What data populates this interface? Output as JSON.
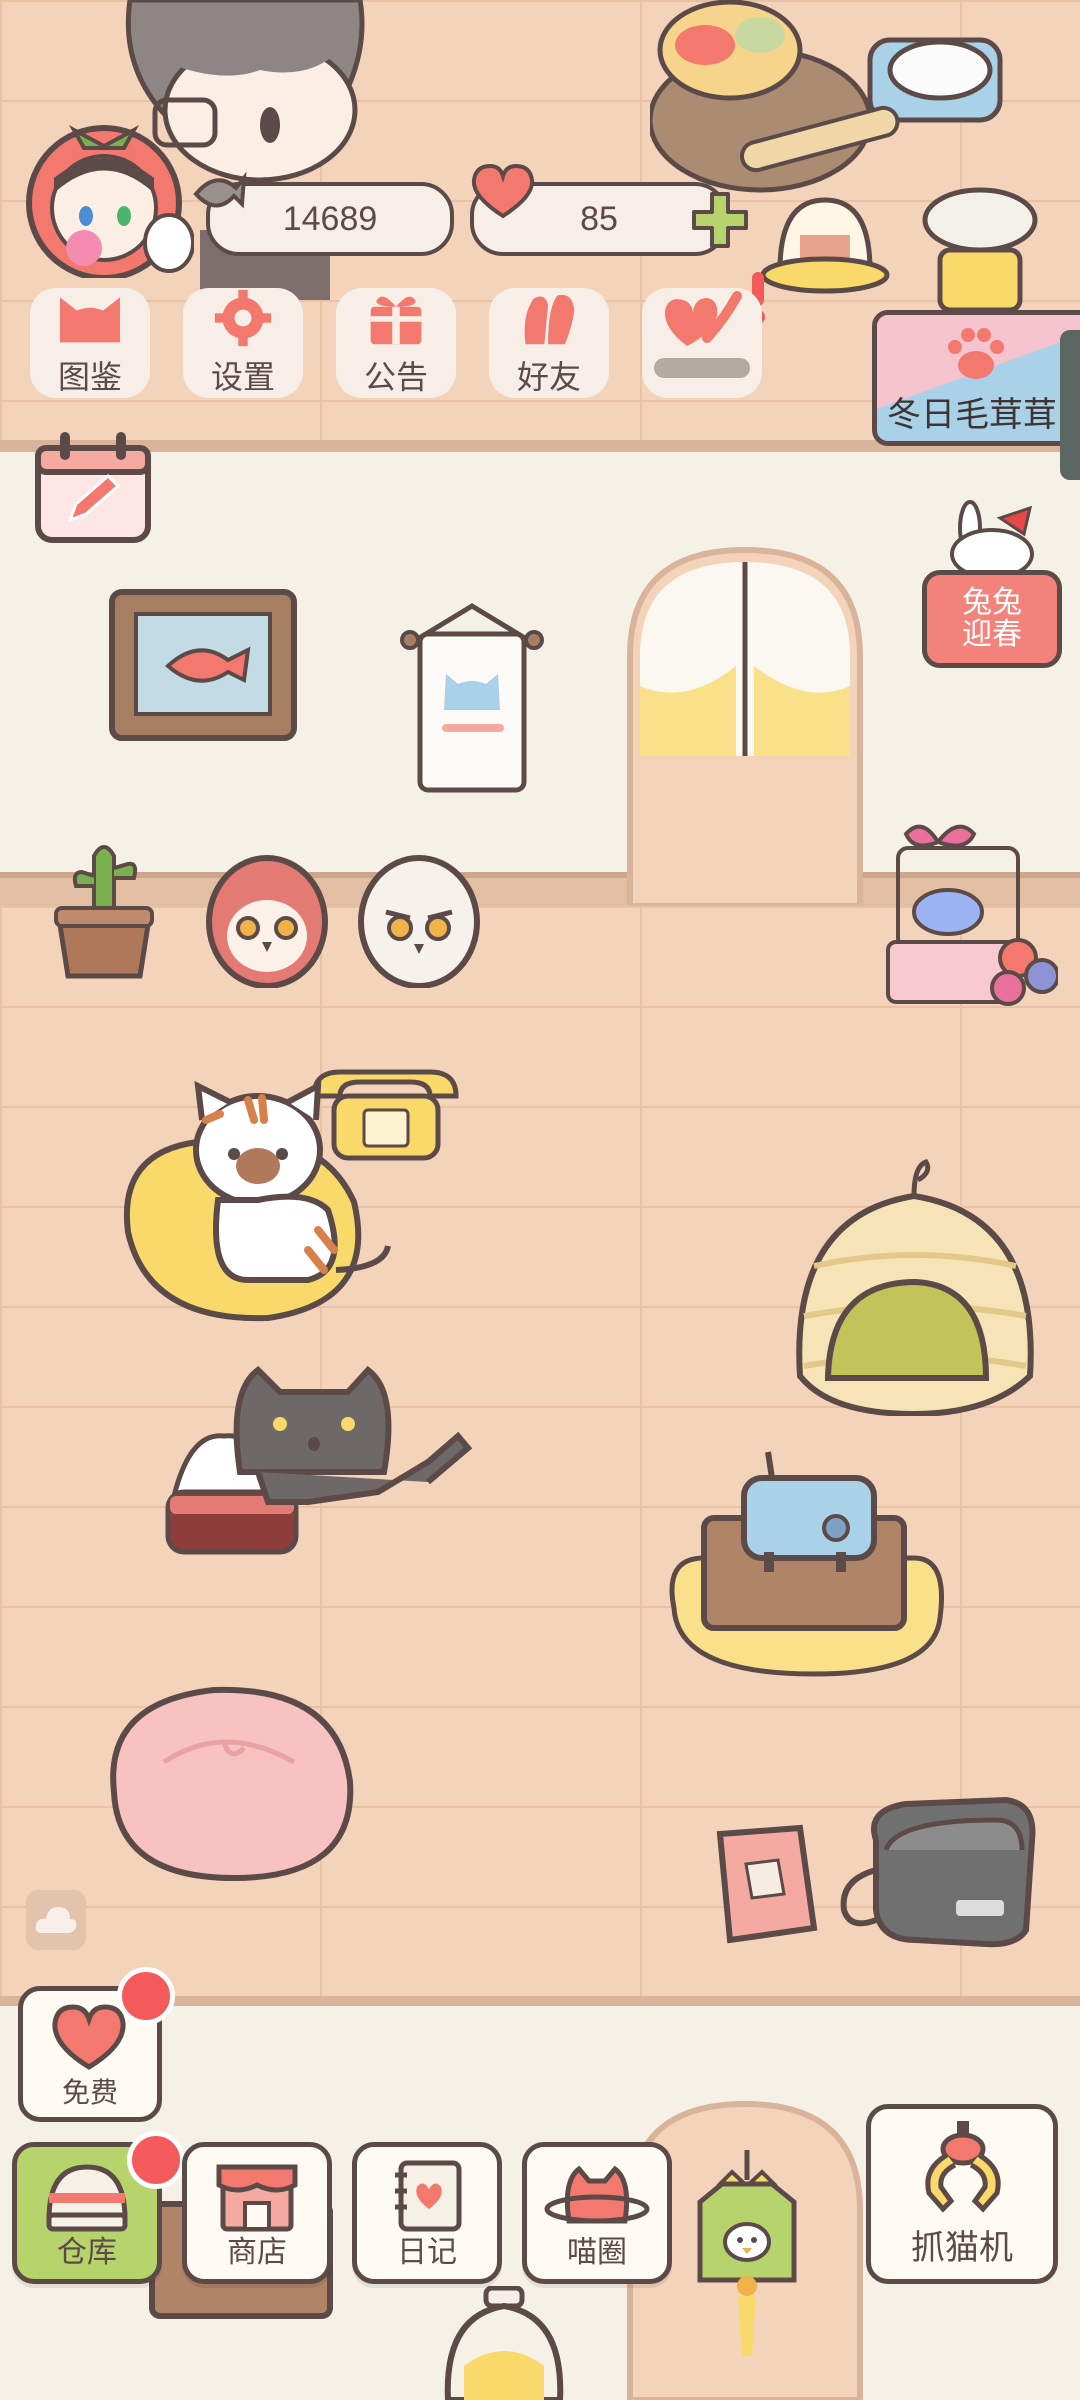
{
  "hud": {
    "coins": "14689",
    "hearts": "85"
  },
  "top_menu": [
    {
      "label": "图鉴",
      "icon": "cat-head-icon"
    },
    {
      "label": "设置",
      "icon": "gear-icon"
    },
    {
      "label": "公告",
      "icon": "gift-icon"
    },
    {
      "label": "好友",
      "icon": "friends-icon"
    },
    {
      "label": "",
      "icon": "hearts-icon"
    }
  ],
  "event_banner": "冬日毛茸茸",
  "spring_event": {
    "line1": "兔兔",
    "line2": "迎春"
  },
  "free_button": "免费",
  "bottom_nav": [
    {
      "label": "仓库",
      "icon": "storage-icon"
    },
    {
      "label": "商店",
      "icon": "shop-icon"
    },
    {
      "label": "日记",
      "icon": "diary-icon"
    },
    {
      "label": "喵圈",
      "icon": "cat-planet-icon"
    }
  ],
  "claw_machine": "抓猫机",
  "colors": {
    "outline": "#5b4a47",
    "coral": "#f3786e",
    "green": "#b7d36c",
    "wall": "#f4d3bb",
    "ivory": "#f6f1e6",
    "badge_red": "#f45a5a"
  }
}
